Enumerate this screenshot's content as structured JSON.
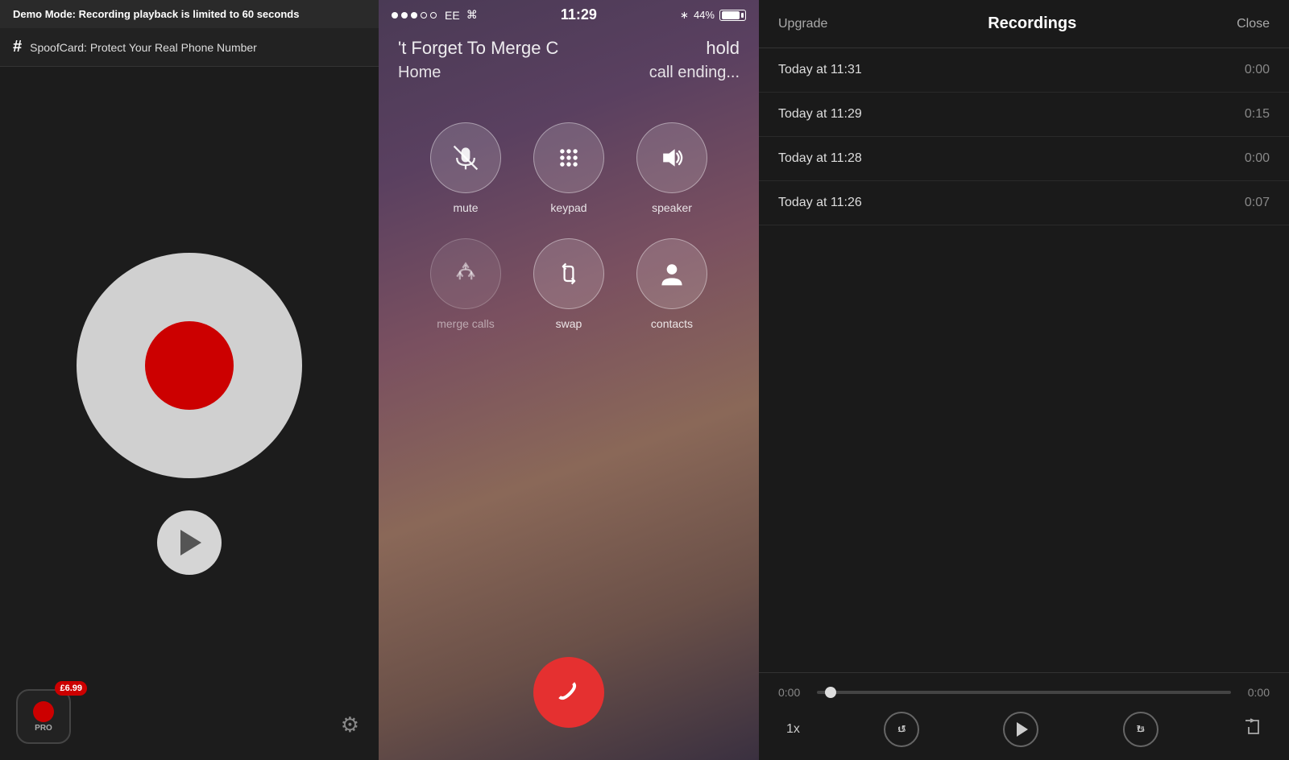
{
  "left": {
    "demo_bar": "Demo Mode:",
    "demo_bar_detail": " Recording playback is limited to 60 seconds",
    "spoof_label": "SpoofCard: Protect Your Real Phone Number",
    "price": "£6.99",
    "pro_label": "PRO"
  },
  "middle": {
    "signal_carrier": "EE",
    "time": "11:29",
    "battery": "44%",
    "call_header": "'t Forget To Merge C",
    "call_hold": "hold",
    "call_home": "Home",
    "call_status": "call ending...",
    "btn_mute": "mute",
    "btn_keypad": "keypad",
    "btn_speaker": "speaker",
    "btn_merge": "merge calls",
    "btn_swap": "swap",
    "btn_contacts": "contacts"
  },
  "right": {
    "upgrade_label": "Upgrade",
    "title": "Recordings",
    "close_label": "Close",
    "recordings": [
      {
        "time": "Today at 11:31",
        "duration": "0:00"
      },
      {
        "time": "Today at 11:29",
        "duration": "0:15"
      },
      {
        "time": "Today at 11:28",
        "duration": "0:00"
      },
      {
        "time": "Today at 11:26",
        "duration": "0:07"
      }
    ],
    "player": {
      "start_time": "0:00",
      "end_time": "0:00",
      "speed": "1x"
    }
  }
}
